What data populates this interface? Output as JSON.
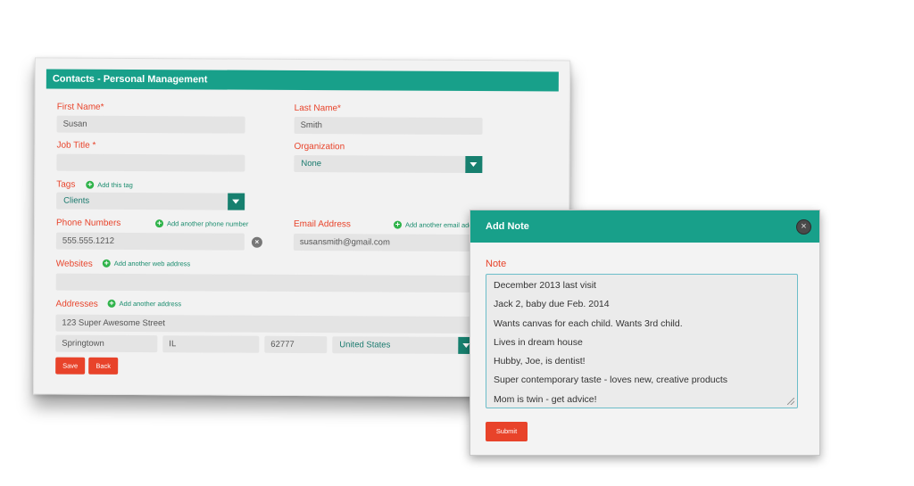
{
  "contacts": {
    "header_title": "Contacts - Personal Management",
    "first_name": {
      "label": "First Name",
      "required": "*",
      "value": "Susan"
    },
    "last_name": {
      "label": "Last Name",
      "required": "*",
      "value": "Smith"
    },
    "job_title": {
      "label": "Job Title",
      "required": " *",
      "value": ""
    },
    "organization": {
      "label": "Organization",
      "value": "None"
    },
    "tags": {
      "label": "Tags",
      "add_link": "Add this tag",
      "value": "Clients"
    },
    "phone": {
      "label": "Phone Numbers",
      "add_link": "Add another phone number",
      "value": "555.555.1212",
      "remove_icon": "x-icon"
    },
    "email": {
      "label": "Email Address",
      "add_link": "Add another email add",
      "value": "susansmith@gmail.com"
    },
    "websites": {
      "label": "Websites",
      "add_link": "Add another web address",
      "value": ""
    },
    "addresses": {
      "label": "Addresses",
      "add_link": "Add another address",
      "street": "123 Super Awesome Street",
      "city": "Springtown",
      "state": "IL",
      "zip": "62777",
      "country": "United States"
    },
    "save_label": "Save",
    "back_label": "Back"
  },
  "add_note_modal": {
    "title": "Add Note",
    "close_icon": "close-icon",
    "note_label": "Note",
    "note_lines": [
      "December 2013 last visit",
      "Jack 2, baby due Feb. 2014",
      "Wants canvas for each child. Wants 3rd child.",
      "Lives in dream house",
      "Hubby, Joe, is dentist!",
      "Super contemporary taste - loves new, creative products",
      "Mom is twin - get advice!"
    ],
    "submit_label": "Submit"
  },
  "colors": {
    "header_teal": "#18a08a",
    "label_red": "#e8432a",
    "button_red": "#e8432a",
    "plus_green": "#2fb34a"
  }
}
